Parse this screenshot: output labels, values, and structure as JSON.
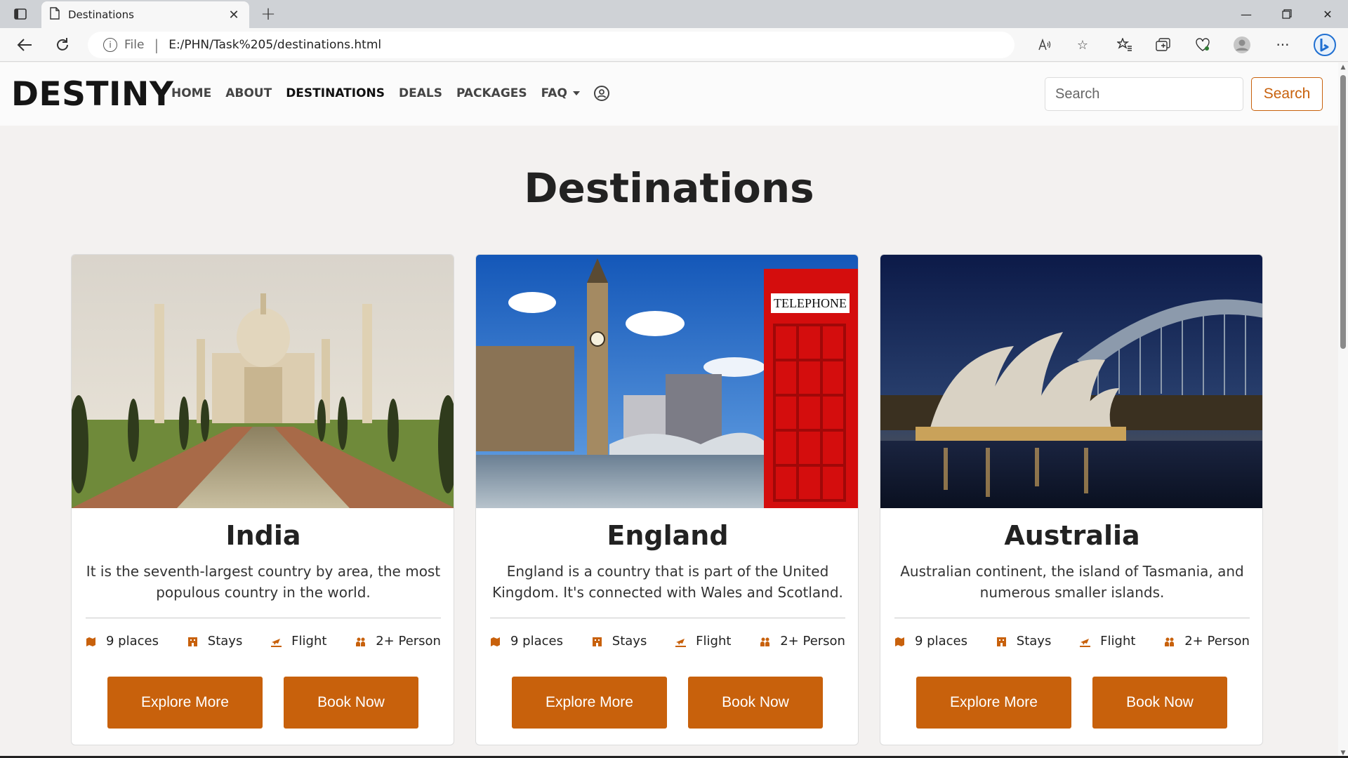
{
  "browser": {
    "tab_title": "Destinations",
    "url_scheme": "File",
    "url": "E:/PHN/Task%205/destinations.html"
  },
  "navbar": {
    "brand": "DESTINY",
    "links": [
      {
        "label": "HOME"
      },
      {
        "label": "ABOUT"
      },
      {
        "label": "DESTINATIONS"
      },
      {
        "label": "DEALS"
      },
      {
        "label": "PACKAGES"
      },
      {
        "label": "FAQ"
      }
    ],
    "search_placeholder": "Search",
    "search_button": "Search"
  },
  "page_title": "Destinations",
  "cards": [
    {
      "title": "India",
      "description": "It is the seventh-largest country by area, the most populous country in the world.",
      "features": [
        "9 places",
        "Stays",
        "Flight",
        "2+ Person"
      ],
      "explore_label": "Explore More",
      "book_label": "Book Now"
    },
    {
      "title": "England",
      "description": "England is a country that is part of the United Kingdom. It's connected with Wales and Scotland.",
      "features": [
        "9 places",
        "Stays",
        "Flight",
        "2+ Person"
      ],
      "explore_label": "Explore More",
      "book_label": "Book Now"
    },
    {
      "title": "Australia",
      "description": "Australian continent, the island of Tasmania, and numerous smaller islands.",
      "features": [
        "9 places",
        "Stays",
        "Flight",
        "2+ Person"
      ],
      "explore_label": "Explore More",
      "book_label": "Book Now"
    }
  ],
  "telephone_sign": "TELEPHONE",
  "colors": {
    "accent": "#c8610c",
    "page_bg": "#f3f1f0"
  },
  "icons": {
    "feature_icons": [
      "map-pin-icon",
      "building-icon",
      "plane-icon",
      "people-icon"
    ]
  }
}
